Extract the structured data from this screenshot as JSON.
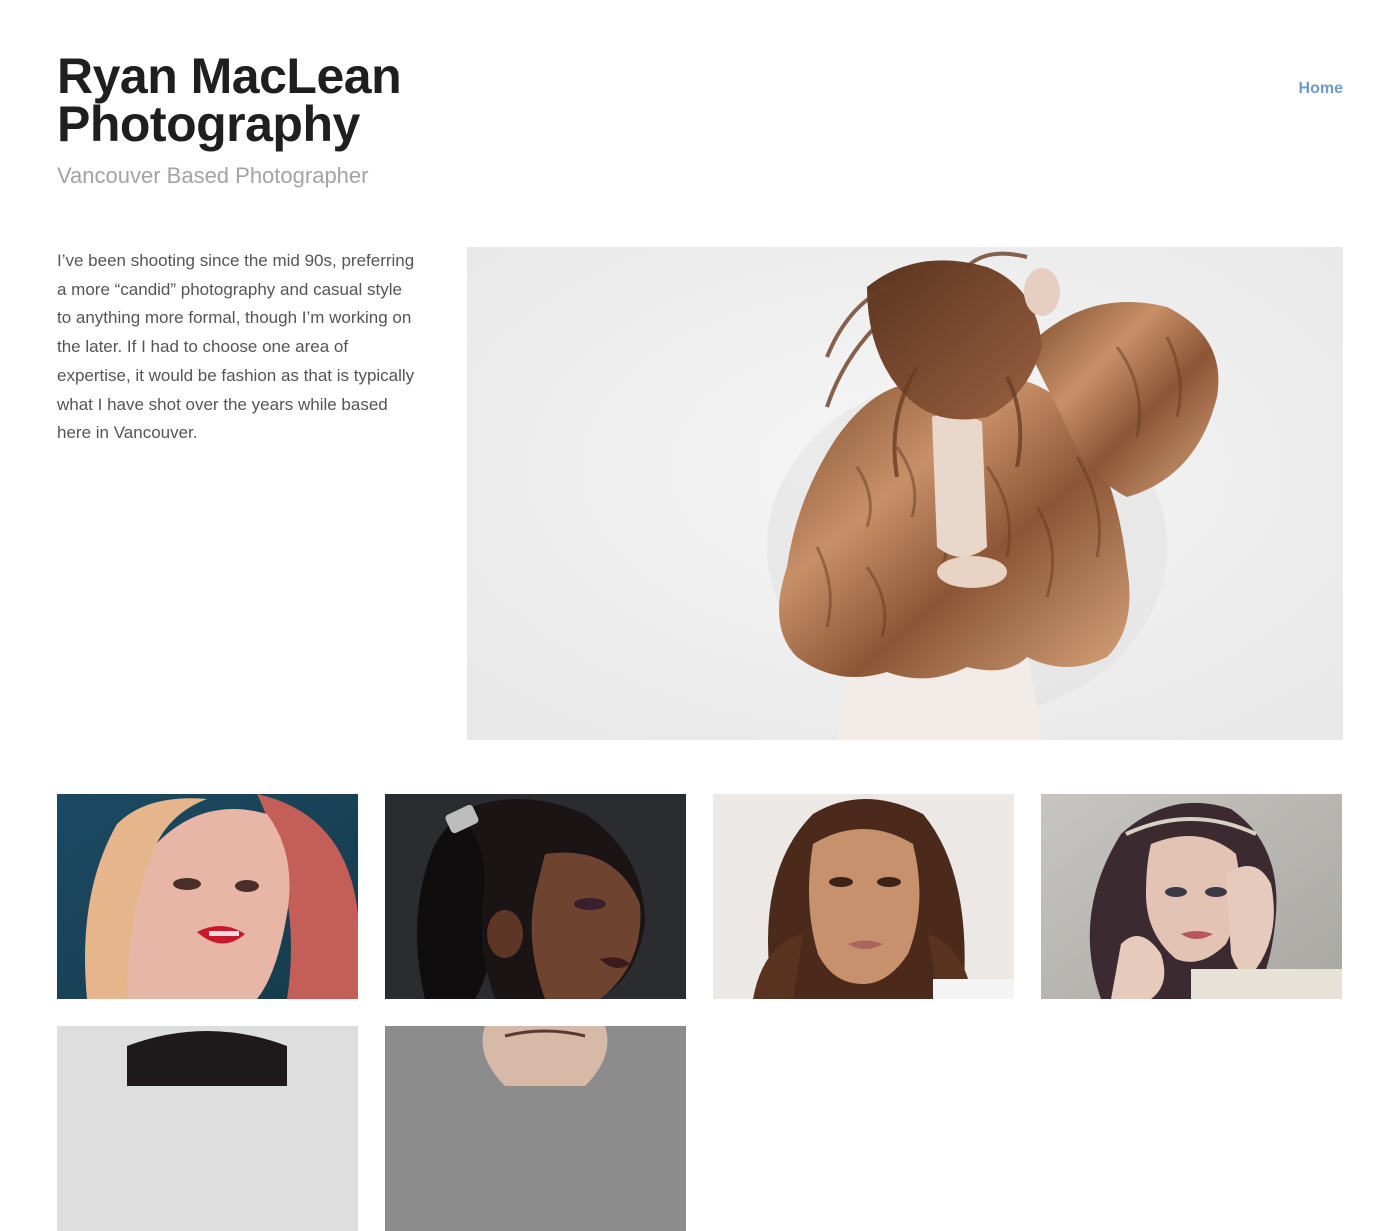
{
  "site": {
    "title": "Ryan MacLean Photography",
    "tagline": "Vancouver Based Photographer"
  },
  "nav": {
    "items": [
      {
        "label": "Home",
        "color": "#6f9ac8"
      }
    ]
  },
  "intro": {
    "text": "I’ve been shooting since the mid 90s, preferring a more “candid” photography and casual style to anything more formal, though I’m working on the later. If I had to choose one area of expertise, it would be fashion as that is typically what I have shot over the years while based here in Vancouver."
  },
  "hero": {
    "subject": "woman-in-fur-coat-photo"
  },
  "gallery": {
    "thumbnails": [
      {
        "subject": "blonde-woman-red-headscarf-photo"
      },
      {
        "subject": "woman-ponytail-profile-photo"
      },
      {
        "subject": "woman-brunette-portrait-photo"
      },
      {
        "subject": "woman-hand-on-face-photo"
      },
      {
        "subject": "portrait-photo"
      },
      {
        "subject": "portrait-photo"
      }
    ]
  },
  "colors": {
    "title": "#1f1f1f",
    "tagline": "#a3a3a3",
    "body_text": "#555555",
    "link": "#6f9ac8"
  }
}
